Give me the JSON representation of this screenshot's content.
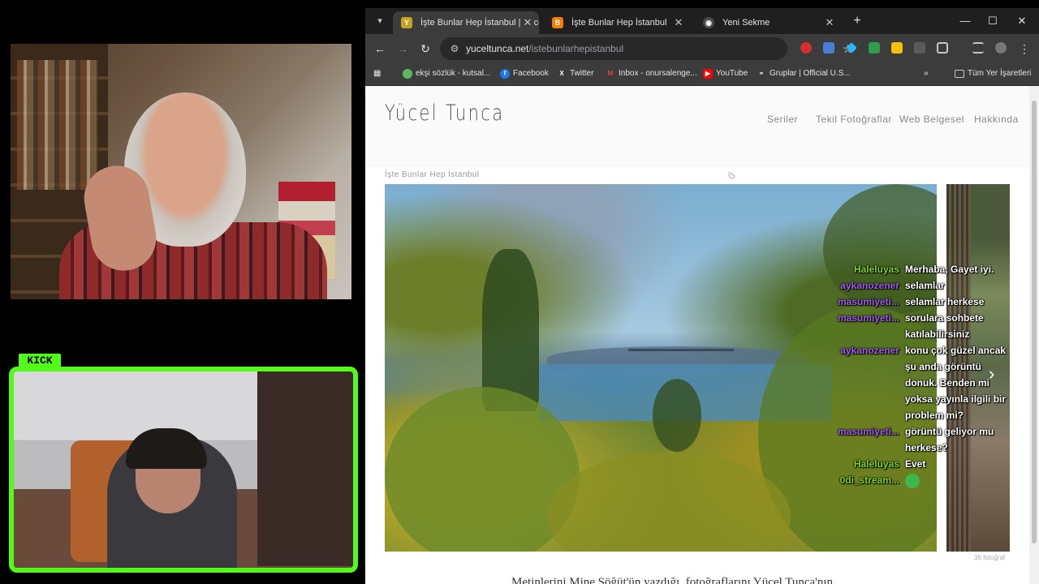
{
  "stream": {
    "kick_badge": "KICK",
    "accent": "#53fc18"
  },
  "browser": {
    "tabs": [
      {
        "title": "İşte Bunlar Hep İstanbul | Yücel",
        "icon": "y-favicon",
        "active": true
      },
      {
        "title": "İşte Bunlar Hep İstanbul",
        "icon": "blogger-favicon",
        "active": false
      },
      {
        "title": "Yeni Sekme",
        "icon": "chrome-favicon",
        "active": false
      }
    ],
    "url_host": "yuceltunca.net",
    "url_path": "/istebunlarhepistanbul",
    "bookmarks": [
      {
        "label": "ekşi sözlük - kutsal...",
        "icon": "eksi-icon"
      },
      {
        "label": "Facebook",
        "icon": "facebook-icon"
      },
      {
        "label": "Twitter",
        "icon": "x-icon"
      },
      {
        "label": "Inbox - onursalenge...",
        "icon": "gmail-icon"
      },
      {
        "label": "YouTube",
        "icon": "youtube-icon"
      },
      {
        "label": "Gruplar | Official U.S...",
        "icon": "link-icon"
      }
    ],
    "all_bookmarks": "Tüm Yer İşaretleri"
  },
  "site": {
    "logo": "Yücel Tunca",
    "menu": [
      "Seriler",
      "Tekil Fotoğraflar",
      "Web Belgesel",
      "Hakkında"
    ],
    "breadcrumb": "İşte Bunlar Hep İstanbul",
    "photo_count": "36 fotoğraf",
    "caption": "Metinlerini Mine Söğüt'ün yazdığı, fotoğraflarını Yücel Tunca'nın"
  },
  "chat": [
    {
      "user": "Haleluyas",
      "color": "#7ed321",
      "text": "Merhaba, Gayet iyi."
    },
    {
      "user": "aykanozener",
      "color": "#a15ce6",
      "text": "selamlar"
    },
    {
      "user": "masumiyeti...",
      "color": "#a15ce6",
      "text": "selamlar herkese"
    },
    {
      "user": "masumiyeti...",
      "color": "#a15ce6",
      "text": "sorulara sohbete katılabilirsiniz"
    },
    {
      "user": "aykanozener",
      "color": "#a15ce6",
      "text": "konu çok güzel ancak şu anda görüntü donuk. Benden mi yoksa yayınla ilgili bir problem mi?"
    },
    {
      "user": "masumiyeti...",
      "color": "#a15ce6",
      "text": "görüntü geliyor mu herkese?"
    },
    {
      "user": "Haleluyas",
      "color": "#7ed321",
      "text": "Evet"
    },
    {
      "user": "0di_stream...",
      "color": "#7ed321",
      "text": "",
      "emote": "green-emote"
    }
  ]
}
